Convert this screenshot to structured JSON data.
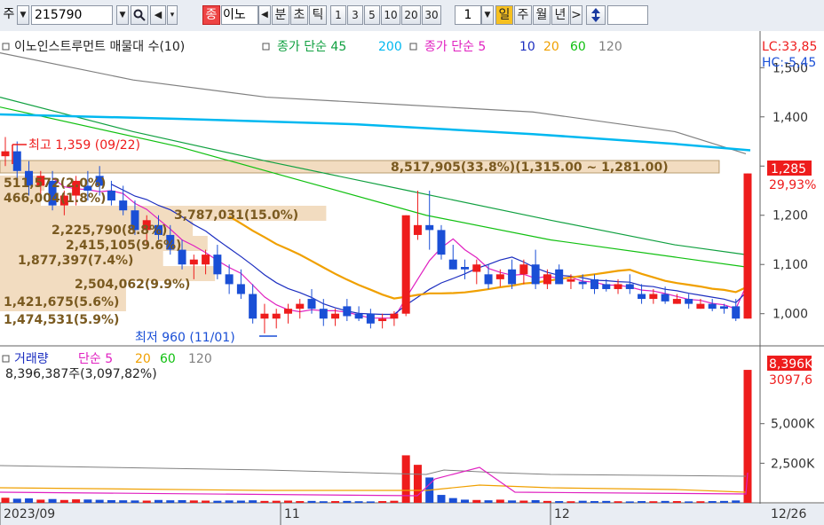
{
  "toolbar": {
    "type_label": "주",
    "code": "215790",
    "chart_btn": "종",
    "name_partial": "이노",
    "periods": [
      "분",
      "초",
      "틱",
      "1",
      "3",
      "5",
      "10",
      "20",
      "30"
    ],
    "period_value": "1",
    "day_label": "일",
    "week_label": "주",
    "month_label": "월",
    "year_label": "년",
    "next": ">"
  },
  "main_legend": {
    "title": "이노인스트루먼트 매물대 수(10)",
    "ma_long_label": "종가 단순 45",
    "ma_long_num": "200",
    "ma_short_label": "종가 단순 5",
    "p10": "10",
    "p20": "20",
    "p60": "60",
    "p120": "120"
  },
  "volume_legend": {
    "label": "거래량",
    "simple": "단순 5",
    "p20": "20",
    "p60": "60",
    "p120": "120"
  },
  "volume_text": "8,396,387주(3,097,82%)",
  "right_labels": {
    "lc": "LC:33,85",
    "hc": "HC:-5,45",
    "price_now": "1,285",
    "price_pct": "29,93%",
    "vol_now": "8,396K",
    "vol_pct": "3097,6"
  },
  "annotations": {
    "high": "최고 1,359 (09/22)",
    "low": "최저 960 (11/01)"
  },
  "price_axis": [
    "1,500",
    "1,400",
    "1,300",
    "1,200",
    "1,100",
    "1,000"
  ],
  "volume_axis": [
    "5,000K",
    "2,500K"
  ],
  "date_axis": [
    "2023/09",
    "11",
    "12",
    "12/26"
  ],
  "volume_profile": [
    {
      "label": "8,517,905(33.8%)(1,315.00 ~ 1,281.00)"
    },
    {
      "label": "511,572(2.0%)"
    },
    {
      "label": "466,004(1.8%)"
    },
    {
      "label": "3,787,031(15.0%)"
    },
    {
      "label": "2,225,790(8.8%)"
    },
    {
      "label": "2,415,105(9.6%)"
    },
    {
      "label": "1,877,397(7.4%)"
    },
    {
      "label": "2,504,062(9.9%)"
    },
    {
      "label": "1,421,675(5.6%)"
    },
    {
      "label": "1,474,531(5.9%)"
    }
  ],
  "colors": {
    "up": "#ee1c1c",
    "down": "#1a4fd6",
    "ma5": "#e020c0",
    "ma10": "#1c2ec0",
    "ma20": "#f0a000",
    "ma60": "#10c010",
    "ma120": "#808080",
    "ma45": "#10a040",
    "ma200": "#00b8f0",
    "profile": "#f2dcc0",
    "profile_text": "#7a5a20"
  },
  "chart_data": {
    "type": "candlestick",
    "price_ylim": [
      960,
      1360
    ],
    "candles": [
      {
        "o": 1320,
        "h": 1359,
        "l": 1300,
        "c": 1330
      },
      {
        "o": 1330,
        "h": 1350,
        "l": 1270,
        "c": 1290
      },
      {
        "o": 1290,
        "h": 1310,
        "l": 1240,
        "c": 1260
      },
      {
        "o": 1260,
        "h": 1290,
        "l": 1240,
        "c": 1280
      },
      {
        "o": 1270,
        "h": 1290,
        "l": 1210,
        "c": 1220
      },
      {
        "o": 1220,
        "h": 1250,
        "l": 1200,
        "c": 1240
      },
      {
        "o": 1240,
        "h": 1280,
        "l": 1220,
        "c": 1270
      },
      {
        "o": 1260,
        "h": 1290,
        "l": 1230,
        "c": 1250
      },
      {
        "o": 1280,
        "h": 1300,
        "l": 1240,
        "c": 1260
      },
      {
        "o": 1250,
        "h": 1270,
        "l": 1220,
        "c": 1230
      },
      {
        "o": 1230,
        "h": 1260,
        "l": 1200,
        "c": 1210
      },
      {
        "o": 1210,
        "h": 1230,
        "l": 1160,
        "c": 1170
      },
      {
        "o": 1170,
        "h": 1200,
        "l": 1140,
        "c": 1190
      },
      {
        "o": 1180,
        "h": 1200,
        "l": 1150,
        "c": 1160
      },
      {
        "o": 1160,
        "h": 1180,
        "l": 1120,
        "c": 1130
      },
      {
        "o": 1130,
        "h": 1150,
        "l": 1090,
        "c": 1100
      },
      {
        "o": 1100,
        "h": 1120,
        "l": 1070,
        "c": 1110
      },
      {
        "o": 1100,
        "h": 1130,
        "l": 1080,
        "c": 1120
      },
      {
        "o": 1120,
        "h": 1140,
        "l": 1070,
        "c": 1080
      },
      {
        "o": 1080,
        "h": 1100,
        "l": 1040,
        "c": 1060
      },
      {
        "o": 1060,
        "h": 1090,
        "l": 1030,
        "c": 1040
      },
      {
        "o": 1040,
        "h": 1060,
        "l": 980,
        "c": 990
      },
      {
        "o": 990,
        "h": 1020,
        "l": 960,
        "c": 1000
      },
      {
        "o": 990,
        "h": 1010,
        "l": 970,
        "c": 1000
      },
      {
        "o": 1000,
        "h": 1020,
        "l": 980,
        "c": 1010
      },
      {
        "o": 1010,
        "h": 1030,
        "l": 990,
        "c": 1020
      },
      {
        "o": 1030,
        "h": 1050,
        "l": 1000,
        "c": 1010
      },
      {
        "o": 1010,
        "h": 1030,
        "l": 975,
        "c": 990
      },
      {
        "o": 990,
        "h": 1010,
        "l": 975,
        "c": 1000
      },
      {
        "o": 1015,
        "h": 1030,
        "l": 985,
        "c": 995
      },
      {
        "o": 1000,
        "h": 1015,
        "l": 985,
        "c": 990
      },
      {
        "o": 1000,
        "h": 1010,
        "l": 970,
        "c": 980
      },
      {
        "o": 985,
        "h": 1000,
        "l": 970,
        "c": 990
      },
      {
        "o": 990,
        "h": 1005,
        "l": 975,
        "c": 1000
      },
      {
        "o": 1000,
        "h": 1200,
        "l": 995,
        "c": 1200
      },
      {
        "o": 1160,
        "h": 1250,
        "l": 1150,
        "c": 1180
      },
      {
        "o": 1180,
        "h": 1250,
        "l": 1130,
        "c": 1170
      },
      {
        "o": 1170,
        "h": 1180,
        "l": 1110,
        "c": 1120
      },
      {
        "o": 1110,
        "h": 1140,
        "l": 1090,
        "c": 1090
      },
      {
        "o": 1095,
        "h": 1110,
        "l": 1070,
        "c": 1090
      },
      {
        "o": 1085,
        "h": 1110,
        "l": 1060,
        "c": 1100
      },
      {
        "o": 1080,
        "h": 1100,
        "l": 1050,
        "c": 1060
      },
      {
        "o": 1070,
        "h": 1090,
        "l": 1055,
        "c": 1080
      },
      {
        "o": 1090,
        "h": 1110,
        "l": 1050,
        "c": 1060
      },
      {
        "o": 1080,
        "h": 1110,
        "l": 1060,
        "c": 1100
      },
      {
        "o": 1100,
        "h": 1130,
        "l": 1050,
        "c": 1060
      },
      {
        "o": 1060,
        "h": 1090,
        "l": 1050,
        "c": 1080
      },
      {
        "o": 1090,
        "h": 1100,
        "l": 1060,
        "c": 1060
      },
      {
        "o": 1065,
        "h": 1080,
        "l": 1050,
        "c": 1070
      },
      {
        "o": 1065,
        "h": 1080,
        "l": 1050,
        "c": 1060
      },
      {
        "o": 1070,
        "h": 1080,
        "l": 1040,
        "c": 1050
      },
      {
        "o": 1060,
        "h": 1070,
        "l": 1045,
        "c": 1050
      },
      {
        "o": 1050,
        "h": 1070,
        "l": 1040,
        "c": 1060
      },
      {
        "o": 1060,
        "h": 1080,
        "l": 1040,
        "c": 1050
      },
      {
        "o": 1040,
        "h": 1060,
        "l": 1020,
        "c": 1030
      },
      {
        "o": 1030,
        "h": 1050,
        "l": 1020,
        "c": 1040
      },
      {
        "o": 1040,
        "h": 1055,
        "l": 1020,
        "c": 1025
      },
      {
        "o": 1020,
        "h": 1040,
        "l": 1020,
        "c": 1030
      },
      {
        "o": 1030,
        "h": 1040,
        "l": 1010,
        "c": 1020
      },
      {
        "o": 1010,
        "h": 1030,
        "l": 1010,
        "c": 1020
      },
      {
        "o": 1020,
        "h": 1030,
        "l": 1005,
        "c": 1010
      },
      {
        "o": 1015,
        "h": 1020,
        "l": 1000,
        "c": 1010
      },
      {
        "o": 1015,
        "h": 1030,
        "l": 985,
        "c": 990
      },
      {
        "o": 990,
        "h": 1285,
        "l": 990,
        "c": 1285
      }
    ],
    "volumes": [
      320,
      260,
      280,
      200,
      240,
      180,
      220,
      210,
      190,
      170,
      160,
      150,
      140,
      180,
      160,
      170,
      150,
      140,
      130,
      150,
      140,
      160,
      120,
      130,
      140,
      110,
      120,
      100,
      110,
      120,
      100,
      90,
      110,
      130,
      3000,
      2400,
      1600,
      500,
      300,
      200,
      180,
      160,
      200,
      150,
      140,
      170,
      120,
      110,
      100,
      130,
      110,
      120,
      100,
      90,
      110,
      100,
      120,
      110,
      90,
      100,
      110,
      120,
      150,
      8396
    ],
    "volume_ylim": [
      0,
      8400
    ]
  }
}
